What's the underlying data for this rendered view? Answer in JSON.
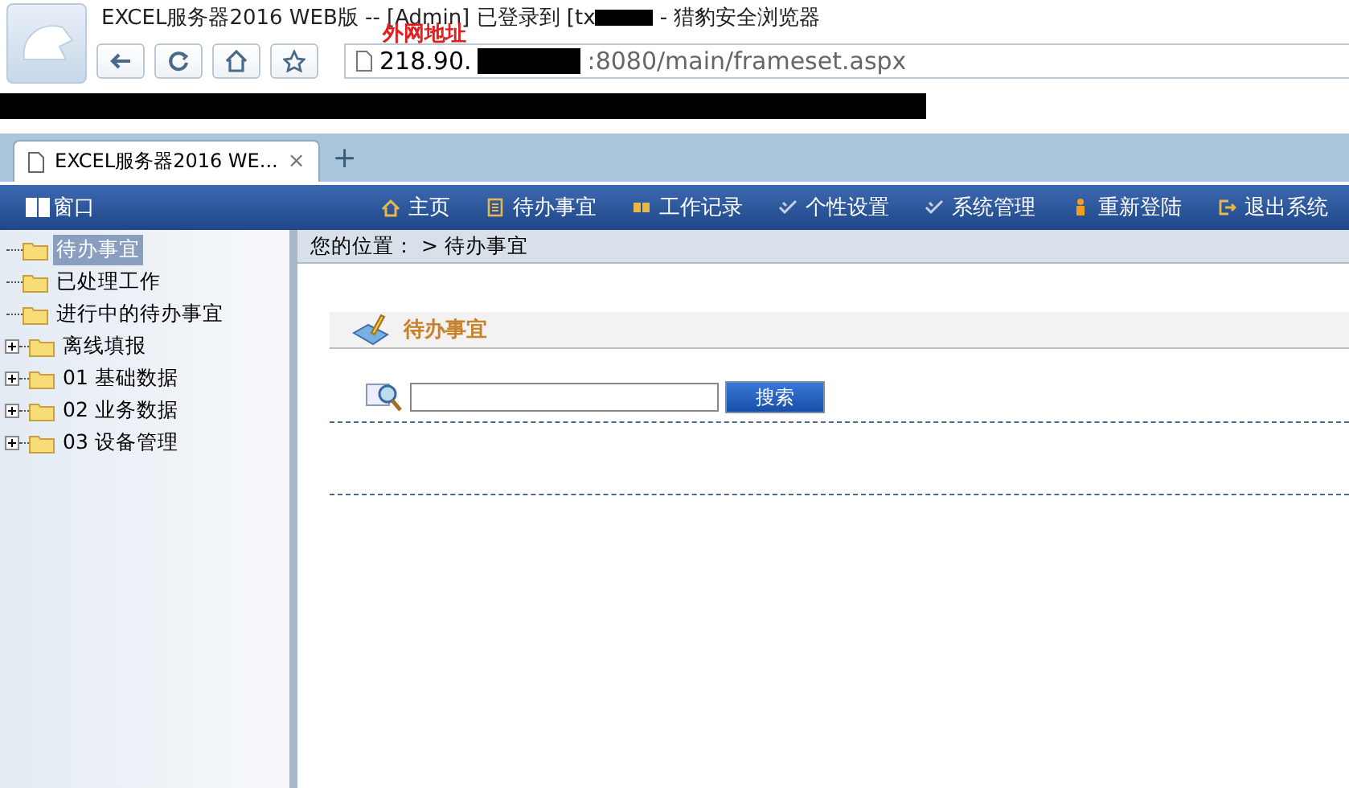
{
  "window": {
    "title": "EXCEL服务器2016 WEB版 -- [Admin] 已登录到 [tx",
    "title_tail": "- 猎豹安全浏览器"
  },
  "address_bar": {
    "url_start": "218.90.",
    "url_end": ":8080/main/frameset.aspx",
    "annotation": "外网地址"
  },
  "tabs": [
    {
      "label": "EXCEL服务器2016 WE...",
      "close": "×",
      "selected": true
    }
  ],
  "new_tab": "+",
  "menu_bar": {
    "window_label": "窗口",
    "items": [
      {
        "label": "主页",
        "kind": "home"
      },
      {
        "label": "待办事宜",
        "kind": "list"
      },
      {
        "label": "工作记录",
        "kind": "book"
      },
      {
        "label": "个性设置",
        "kind": "check"
      },
      {
        "label": "系统管理",
        "kind": "check"
      },
      {
        "label": "重新登陆",
        "kind": "person"
      },
      {
        "label": "退出系统",
        "kind": "exit"
      }
    ]
  },
  "sidebar": {
    "items": [
      {
        "label": "待办事宜",
        "kind": "leaf",
        "selected": true
      },
      {
        "label": "已处理工作",
        "kind": "leaf",
        "selected": false
      },
      {
        "label": "进行中的待办事宜",
        "kind": "leaf",
        "selected": false
      },
      {
        "label": "离线填报",
        "kind": "branch",
        "expanded": false,
        "selected": false
      },
      {
        "label": "01 基础数据",
        "kind": "branch",
        "expanded": false,
        "selected": false
      },
      {
        "label": "02 业务数据",
        "kind": "branch",
        "expanded": false,
        "selected": false
      },
      {
        "label": "03 设备管理",
        "kind": "branch",
        "expanded": false,
        "selected": false
      }
    ]
  },
  "breadcrumb": "您的位置： > 待办事宜",
  "panel": {
    "title": "待办事宜",
    "search_button": "搜索"
  }
}
